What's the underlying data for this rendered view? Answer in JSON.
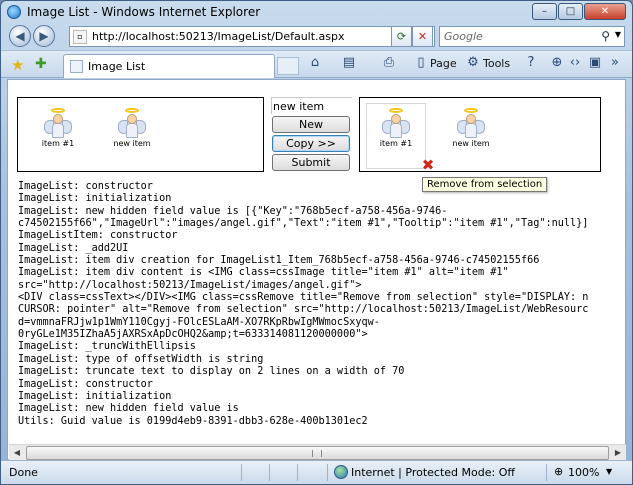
{
  "window": {
    "title": "Image List - Windows Internet Explorer",
    "minimize": "–",
    "maximize": "□",
    "close": "✕"
  },
  "address": {
    "url": "http://localhost:50213/ImageList/Default.aspx",
    "search_placeholder": "Google"
  },
  "tab": {
    "label": "Image List"
  },
  "commands": {
    "page": "Page",
    "tools": "Tools"
  },
  "panels": {
    "left_items": [
      {
        "label": "item #1"
      },
      {
        "label": "new item"
      }
    ],
    "right_items": [
      {
        "label": "item #1"
      },
      {
        "label": "new item"
      }
    ]
  },
  "controls": {
    "input_value": "new item",
    "new_label": "New",
    "copy_label": "Copy >>",
    "submit_label": "Submit"
  },
  "tooltip": "Remove from selection",
  "log_lines": [
    "ImageList: constructor",
    "ImageList: initialization",
    "ImageList: new hidden field value is [{\"Key\":\"768b5ecf-a758-456a-9746-",
    "c74502155f66\",\"ImageUrl\":\"images/angel.gif\",\"Text\":\"item #1\",\"Tooltip\":\"item #1\",\"Tag\":null}]",
    "ImageListItem: constructor",
    "ImageList: _add2UI",
    "ImageList: item div creation for ImageList1_Item_768b5ecf-a758-456a-9746-c74502155f66",
    "ImageList: item div content is <IMG class=cssImage title=\"item #1\" alt=\"item #1\"",
    "src=\"http://localhost:50213/ImageList/images/angel.gif\">",
    "<DIV class=cssText></DIV><IMG class=cssRemove title=\"Remove from selection\" style=\"DISPLAY: n",
    "CURSOR: pointer\" alt=\"Remove from selection\" src=\"http://localhost:50213/ImageList/WebResourc",
    "d=vmmnaFRJjw1p1WmY110Cgyj-FOlcESLaAM-XO7RKpRbwIgMWmocSxyqw-",
    "0ryGLe1M35IZhaA5jAXRSxApDcOHQ2&amp;t=633314081120000000\">",
    "ImageList: _truncWithEllipsis",
    "ImageList: type of offsetWidth is string",
    "ImageList: truncate text to display on 2 lines on a width of 70",
    "ImageList: constructor",
    "ImageList: initialization",
    "ImageList: new hidden field value is",
    "Utils: Guid value is 0199d4eb9-8391-dbb3-628e-400b1301ec2"
  ],
  "status": {
    "text": "Done",
    "zone": "Internet | Protected Mode: Off",
    "zoom": "100%"
  }
}
